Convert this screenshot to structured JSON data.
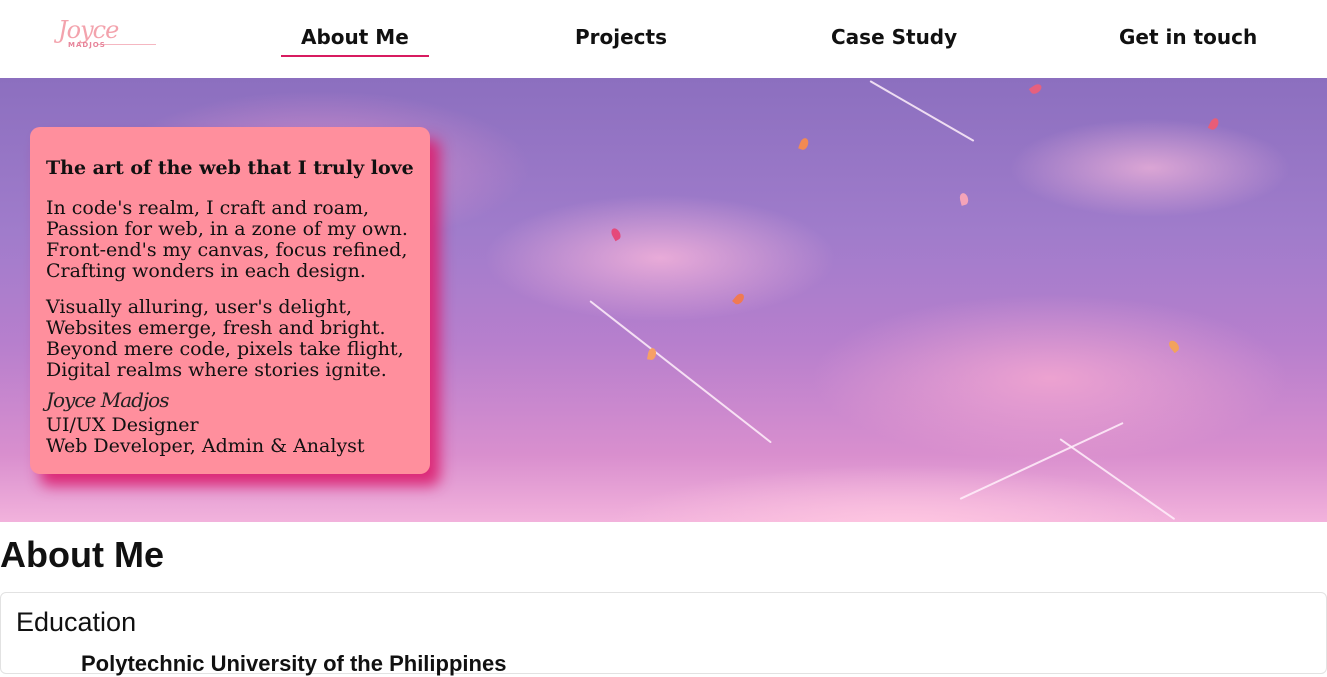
{
  "logo": {
    "script_text": "Joyce",
    "sub_text": "MADJOS"
  },
  "nav": {
    "items": [
      {
        "label": "About Me",
        "active": true
      },
      {
        "label": "Projects",
        "active": false
      },
      {
        "label": "Case Study",
        "active": false
      },
      {
        "label": "Get in touch",
        "active": false
      }
    ]
  },
  "hero": {
    "card": {
      "title": "The art of the web that I truly love",
      "stanza1": [
        "In code's realm, I craft and roam,",
        "Passion for web, in a zone of my own.",
        "Front-end's my canvas, focus refined,",
        "Crafting wonders in each design."
      ],
      "stanza2": [
        "Visually alluring, user's delight,",
        "Websites emerge, fresh and bright.",
        "Beyond mere code, pixels take flight,",
        "Digital realms where stories ignite."
      ],
      "signature": "Joyce Madjos",
      "roles": [
        "UI/UX Designer",
        "Web Developer, Admin & Analyst"
      ]
    }
  },
  "about": {
    "heading": "About Me",
    "education": {
      "title": "Education",
      "first_item": "Polytechnic University of the Philippines"
    }
  },
  "colors": {
    "accent": "#d81b60",
    "card_bg": "#ff8f9d",
    "card_shadow": "#dc1e6e"
  }
}
